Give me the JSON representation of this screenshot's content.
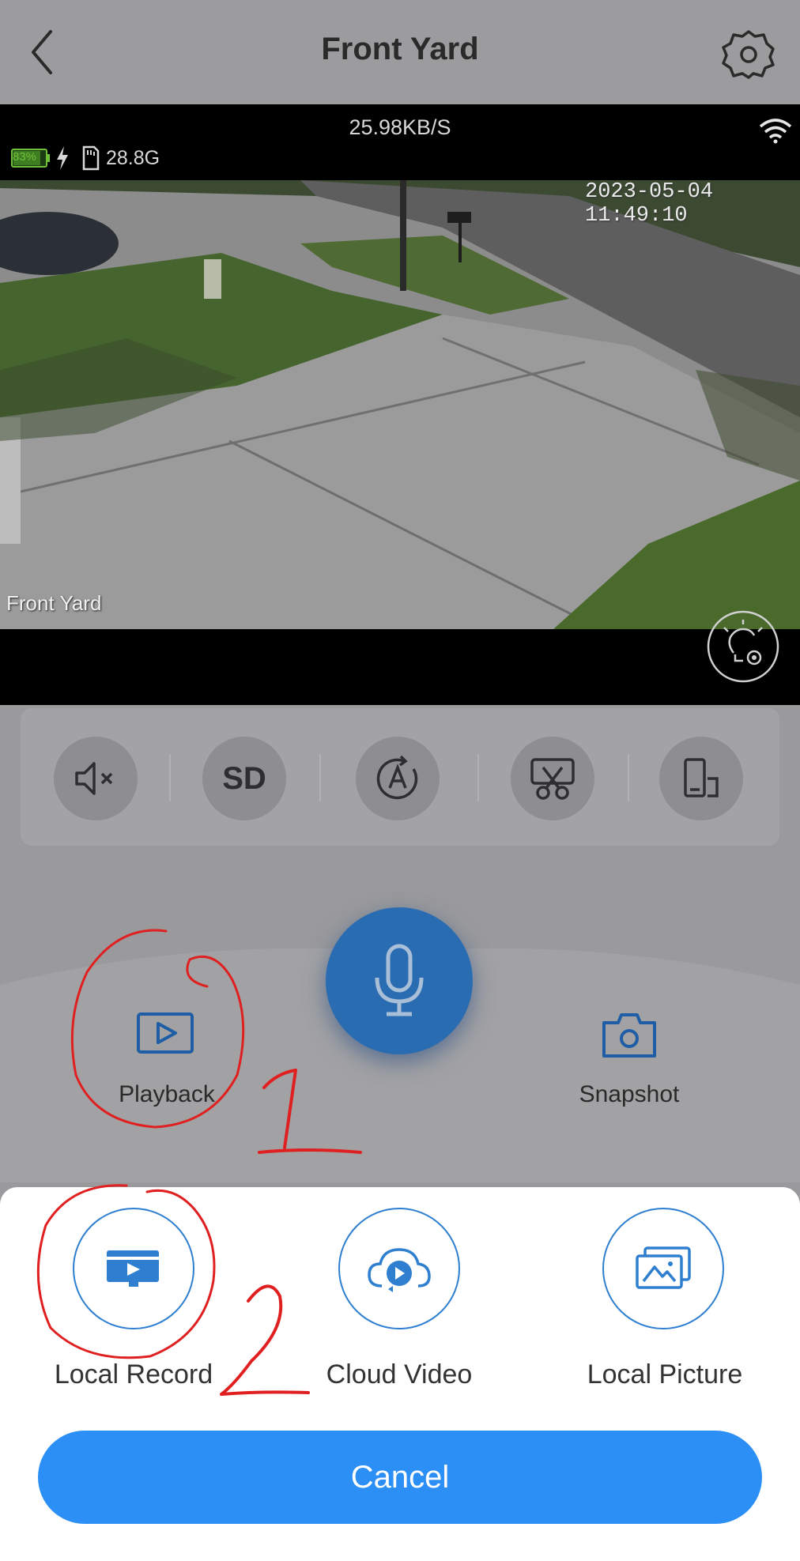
{
  "header": {
    "title": "Front Yard",
    "back_icon": "chevron-left-icon",
    "settings_icon": "gear-icon"
  },
  "video": {
    "rate": "25.98KB/S",
    "battery": "83%",
    "storage": "28.8G",
    "timestamp": "2023-05-04 11:49:10",
    "camera_name": "Front Yard"
  },
  "toolbar": {
    "sd_label": "SD",
    "icons": [
      "mute-icon",
      "sd-quality",
      "auto-track-icon",
      "cut-icon",
      "device-rotate-icon"
    ]
  },
  "actions": {
    "playback": "Playback",
    "snapshot": "Snapshot",
    "talk_icon": "microphone-icon"
  },
  "sheet": {
    "options": [
      "Local Record",
      "Cloud Video",
      "Local Picture"
    ],
    "cancel": "Cancel"
  },
  "annotations": {
    "step1": "1",
    "step2": "2",
    "color": "#e02020"
  },
  "colors": {
    "accent": "#2b8ff5",
    "mic": "#2a6cb2",
    "icon_blue": "#2f7fd0"
  }
}
